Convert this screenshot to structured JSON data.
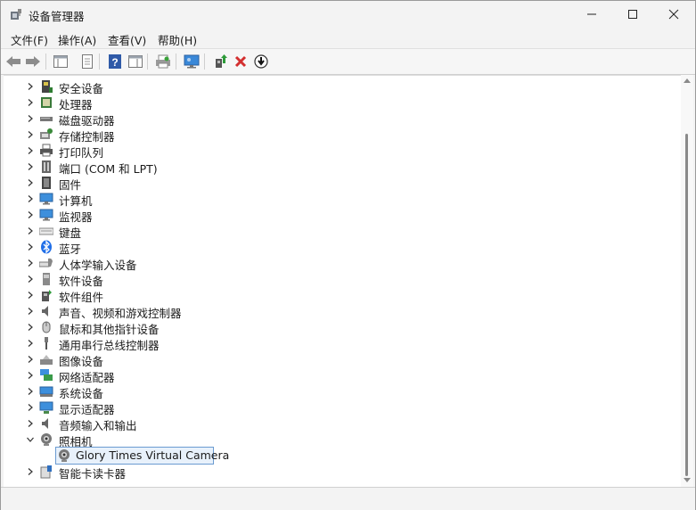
{
  "window": {
    "title": "设备管理器"
  },
  "menu": [
    "文件(F)",
    "操作(A)",
    "查看(V)",
    "帮助(H)"
  ],
  "tree": {
    "items": [
      {
        "label": "安全设备",
        "icon": "security-device-icon"
      },
      {
        "label": "处理器",
        "icon": "processor-icon"
      },
      {
        "label": "磁盘驱动器",
        "icon": "disk-drive-icon"
      },
      {
        "label": "存储控制器",
        "icon": "storage-controller-icon"
      },
      {
        "label": "打印队列",
        "icon": "printer-icon"
      },
      {
        "label": "端口 (COM 和 LPT)",
        "icon": "port-icon"
      },
      {
        "label": "固件",
        "icon": "firmware-icon"
      },
      {
        "label": "计算机",
        "icon": "computer-icon"
      },
      {
        "label": "监视器",
        "icon": "monitor-icon"
      },
      {
        "label": "键盘",
        "icon": "keyboard-icon"
      },
      {
        "label": "蓝牙",
        "icon": "bluetooth-icon"
      },
      {
        "label": "人体学输入设备",
        "icon": "hid-icon"
      },
      {
        "label": "软件设备",
        "icon": "software-device-icon"
      },
      {
        "label": "软件组件",
        "icon": "software-component-icon"
      },
      {
        "label": "声音、视频和游戏控制器",
        "icon": "speaker-icon"
      },
      {
        "label": "鼠标和其他指针设备",
        "icon": "mouse-icon"
      },
      {
        "label": "通用串行总线控制器",
        "icon": "usb-icon"
      },
      {
        "label": "图像设备",
        "icon": "imaging-device-icon"
      },
      {
        "label": "网络适配器",
        "icon": "network-adapter-icon"
      },
      {
        "label": "系统设备",
        "icon": "system-device-icon"
      },
      {
        "label": "显示适配器",
        "icon": "display-adapter-icon"
      },
      {
        "label": "音频输入和输出",
        "icon": "audio-io-icon"
      },
      {
        "label": "照相机",
        "icon": "camera-icon",
        "expanded": true
      },
      {
        "label": "Glory Times Virtual Camera",
        "icon": "webcam-icon",
        "child": true,
        "selected": true
      },
      {
        "label": "智能卡读卡器",
        "icon": "smart-card-reader-icon"
      }
    ]
  },
  "colors": {
    "selection": "#e8f1fb",
    "selection_border": "#6b9bd1",
    "delete_red": "#d32f2f"
  }
}
